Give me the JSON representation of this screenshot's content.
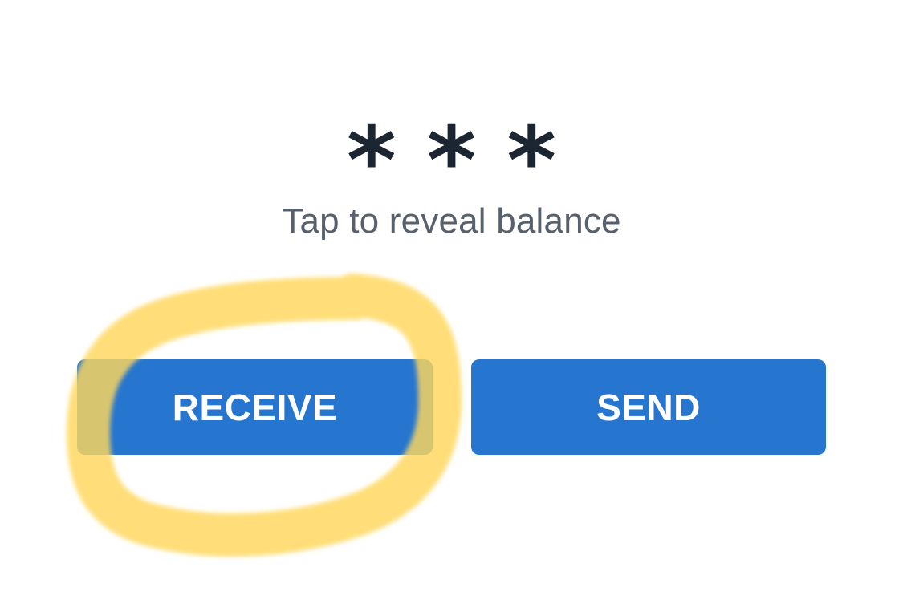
{
  "balance": {
    "masked_glyphs": [
      "*",
      "*",
      "*"
    ],
    "reveal_hint": "Tap to reveal balance"
  },
  "actions": {
    "receive_label": "RECEIVE",
    "send_label": "SEND"
  },
  "colors": {
    "button_primary": "#2675cf",
    "button_text": "#ffffff",
    "balance_mask": "#1c2633",
    "hint_text": "#56616d",
    "annotation_highlight": "#ffd75a"
  }
}
